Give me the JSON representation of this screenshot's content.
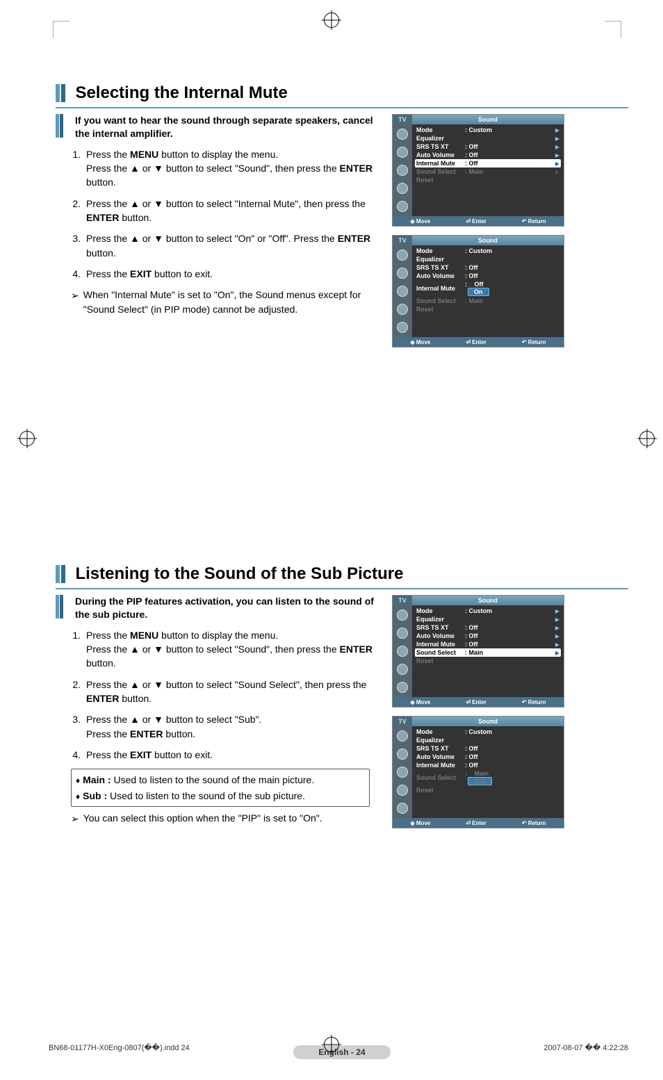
{
  "page_badge": "English - 24",
  "footer": {
    "left": "BN68-01177H-X0Eng-0807(��).indd   24",
    "right": "2007-08-07   �� 4:22:28"
  },
  "section1": {
    "title": "Selecting the Internal Mute",
    "intro": "If you want to hear the sound through separate speakers, cancel the internal amplifier.",
    "steps": [
      "Press the <b>MENU</b> button to display the menu.<br>Press the ▲ or ▼ button to select \"Sound\", then press the <b>ENTER</b> button.",
      "Press the ▲ or ▼ button to select \"Internal Mute\", then press the <b>ENTER</b> button.",
      "Press the ▲ or ▼ button to select \"On\" or \"Off\". Press the <b>ENTER</b> button.",
      "Press the <b>EXIT</b> button to exit."
    ],
    "note": "When \"Internal Mute\" is set to \"On\", the Sound menus except for \"Sound Select\" (in PIP mode) cannot be adjusted."
  },
  "section2": {
    "title": "Listening to the Sound of the Sub Picture",
    "intro": "During the PIP features activation, you can listen to the sound of the sub picture.",
    "steps": [
      "Press the <b>MENU</b> button to display the menu.<br>Press the ▲ or ▼ button to select \"Sound\", then press the <b>ENTER</b> button.",
      "Press the ▲ or ▼ button to select \"Sound Select\", then press the <b>ENTER</b> button.",
      "Press the ▲ or ▼ button to select \"Sub\".<br>Press the <b>ENTER</b> button.",
      "Press the <b>EXIT</b> button to exit."
    ],
    "box": {
      "main": "<b>Main :</b> Used to listen to the sound of the main picture.",
      "sub": "<b>Sub :</b>  Used to listen to the sound of the sub picture."
    },
    "note": "You can select this option when the \"PIP\" is set to \"On\"."
  },
  "osd_common": {
    "tv": "TV",
    "title": "Sound",
    "ftr_move": "Move",
    "ftr_enter": "Enter",
    "ftr_return": "Return"
  },
  "osd1a": {
    "rows": [
      {
        "lbl": "Mode",
        "val": ": Custom",
        "sel": false,
        "dim": false,
        "caret": true
      },
      {
        "lbl": "Equalizer",
        "val": "",
        "sel": false,
        "dim": false,
        "caret": true
      },
      {
        "lbl": "SRS TS XT",
        "val": ": Off",
        "sel": false,
        "dim": false,
        "caret": true
      },
      {
        "lbl": "Auto Volume",
        "val": ": Off",
        "sel": false,
        "dim": false,
        "caret": true
      },
      {
        "lbl": "Internal Mute",
        "val": ": Off",
        "sel": true,
        "dim": false,
        "caret": true
      },
      {
        "lbl": "Sound Select",
        "val": ": Main",
        "sel": false,
        "dim": true,
        "caret": true
      },
      {
        "lbl": "Reset",
        "val": "",
        "sel": false,
        "dim": true,
        "caret": false
      }
    ]
  },
  "osd1b": {
    "rows": [
      {
        "lbl": "Mode",
        "val": ": Custom"
      },
      {
        "lbl": "Equalizer",
        "val": ""
      },
      {
        "lbl": "SRS TS XT",
        "val": ": Off"
      },
      {
        "lbl": "Auto Volume",
        "val": ": Off"
      },
      {
        "lbl": "Internal Mute",
        "opts": [
          "Off",
          "On"
        ],
        "sel_idx": 1
      },
      {
        "lbl": "Sound Select",
        "val": ": Main",
        "dim": true
      },
      {
        "lbl": "Reset",
        "val": "",
        "dim": true
      }
    ]
  },
  "osd2a": {
    "rows": [
      {
        "lbl": "Mode",
        "val": ": Custom",
        "caret": true
      },
      {
        "lbl": "Equalizer",
        "val": "",
        "caret": true
      },
      {
        "lbl": "SRS TS XT",
        "val": ": Off",
        "caret": true
      },
      {
        "lbl": "Auto Volume",
        "val": ": Off",
        "caret": true
      },
      {
        "lbl": "Internal Mute",
        "val": ": Off",
        "caret": true
      },
      {
        "lbl": "Sound Select",
        "val": ": Main",
        "sel": true,
        "caret": true
      },
      {
        "lbl": "Reset",
        "val": "",
        "dim": true
      }
    ]
  },
  "osd2b": {
    "rows": [
      {
        "lbl": "Mode",
        "val": ": Custom"
      },
      {
        "lbl": "Equalizer",
        "val": ""
      },
      {
        "lbl": "SRS TS XT",
        "val": ": Off"
      },
      {
        "lbl": "Auto Volume",
        "val": ": Off"
      },
      {
        "lbl": "Internal Mute",
        "val": ": Off"
      },
      {
        "lbl": "Sound Select",
        "opts": [
          "Main",
          "Sub"
        ],
        "sel_idx": 1,
        "dim": true
      },
      {
        "lbl": "Reset",
        "val": "",
        "dim": true
      }
    ]
  }
}
